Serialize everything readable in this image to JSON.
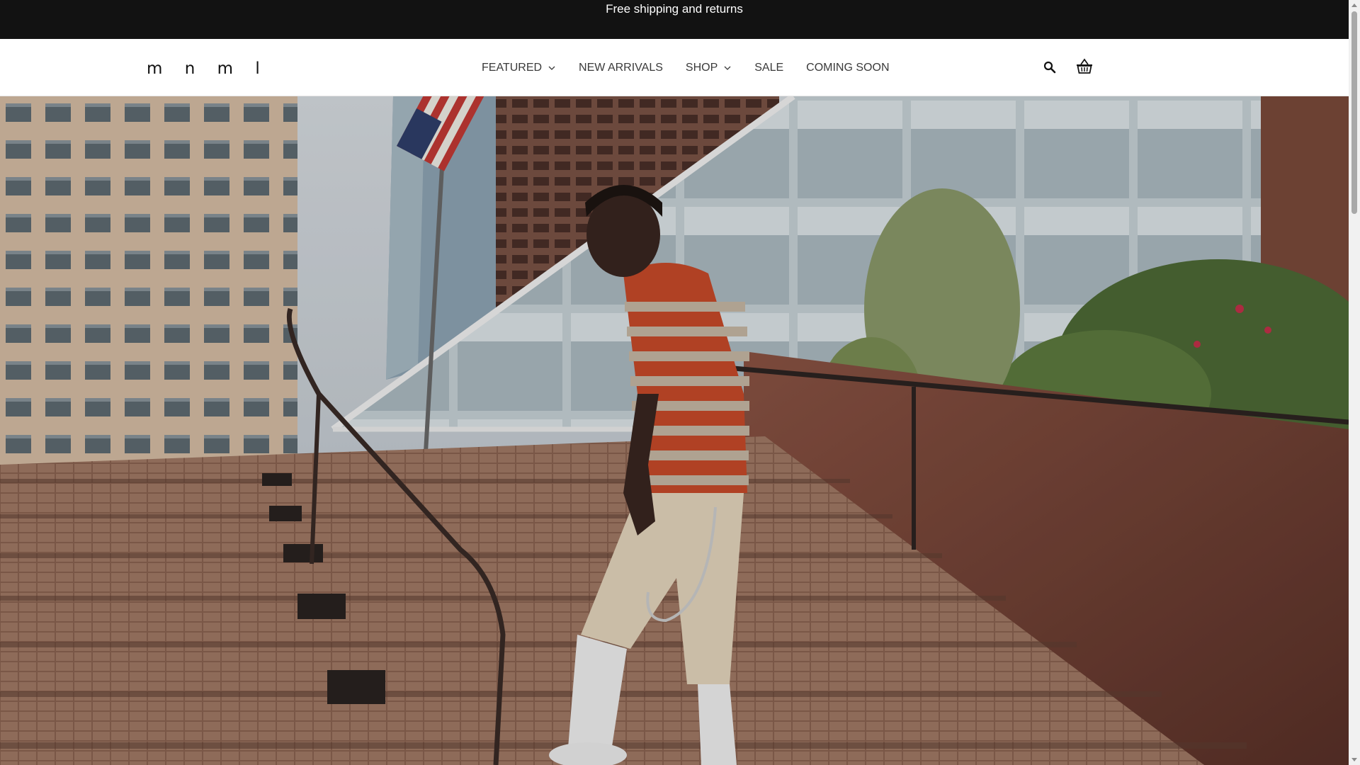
{
  "announcement": {
    "text": "Free shipping and returns"
  },
  "header": {
    "logo": "m n m l",
    "nav": [
      {
        "label": "FEATURED",
        "has_dropdown": true
      },
      {
        "label": "NEW ARRIVALS",
        "has_dropdown": false
      },
      {
        "label": "SHOP",
        "has_dropdown": true
      },
      {
        "label": "SALE",
        "has_dropdown": false
      },
      {
        "label": "COMING SOON",
        "has_dropdown": false
      }
    ],
    "icons": {
      "search": "search-icon",
      "cart": "basket-icon"
    }
  },
  "hero": {
    "image_subject": "model walking down brick stairs beside glass building with flag"
  },
  "colors": {
    "announcement_bg": "#121212",
    "header_bg": "#ffffff",
    "nav_text": "#3a3a3a"
  }
}
